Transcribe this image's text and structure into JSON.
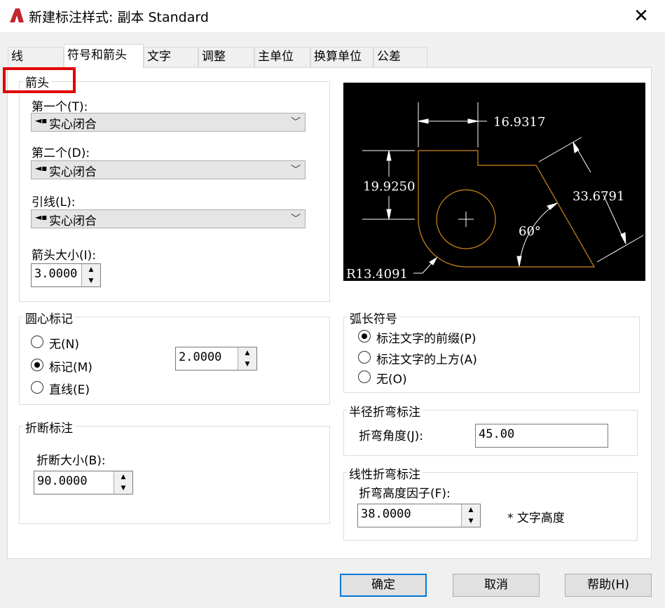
{
  "window": {
    "title": "新建标注样式: 副本 Standard",
    "icon": "autocad-logo-icon",
    "close_glyph": "✕"
  },
  "tabs": [
    {
      "label": "线",
      "active": false
    },
    {
      "label": "符号和箭头",
      "active": true
    },
    {
      "label": "文字",
      "active": false
    },
    {
      "label": "调整",
      "active": false
    },
    {
      "label": "主单位",
      "active": false
    },
    {
      "label": "换算单位",
      "active": false
    },
    {
      "label": "公差",
      "active": false
    }
  ],
  "arrows": {
    "group_label": "箭头",
    "first_label": "第一个(T):",
    "first_value": "实心闭合",
    "second_label": "第二个(D):",
    "second_value": "实心闭合",
    "leader_label": "引线(L):",
    "leader_value": "实心闭合",
    "size_label": "箭头大小(I):",
    "size_value": "3.0000"
  },
  "center_mark": {
    "group_label": "圆心标记",
    "options": [
      "无(N)",
      "标记(M)",
      "直线(E)"
    ],
    "selected": 1,
    "size_value": "2.0000"
  },
  "dim_break": {
    "group_label": "折断标注",
    "size_label": "折断大小(B):",
    "size_value": "90.0000"
  },
  "arc_length": {
    "group_label": "弧长符号",
    "options": [
      "标注文字的前缀(P)",
      "标注文字的上方(A)",
      "无(O)"
    ],
    "selected": 0
  },
  "radius_jog": {
    "group_label": "半径折弯标注",
    "angle_label": "折弯角度(J):",
    "angle_value": "45.00"
  },
  "linear_jog": {
    "group_label": "线性折弯标注",
    "factor_label": "折弯高度因子(F):",
    "factor_value": "38.0000",
    "suffix": "* 文字高度"
  },
  "preview": {
    "dim_top": "16.9317",
    "dim_left": "19.9250",
    "dim_right": "33.6791",
    "angle": "60°",
    "radius": "R13.4091",
    "geometry_color": "#d08a1c",
    "dim_color": "#ffffff",
    "background": "#000000"
  },
  "buttons": {
    "ok": "确定",
    "cancel": "取消",
    "help": "帮助(H)"
  },
  "highlight_color": "#e00000"
}
